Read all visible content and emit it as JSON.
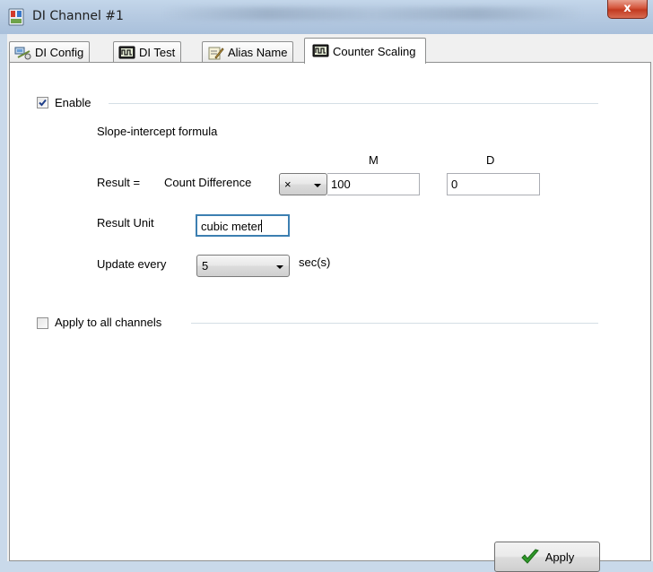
{
  "window": {
    "title": "DI Channel #1",
    "close_label": "x"
  },
  "tabs": [
    {
      "label": "DI Config",
      "icon": "network-config-icon",
      "active": false
    },
    {
      "label": "DI Test",
      "icon": "signal-monitor-icon",
      "active": false
    },
    {
      "label": "Alias Name",
      "icon": "pencil-note-icon",
      "active": false
    },
    {
      "label": "Counter Scaling",
      "icon": "signal-monitor-icon",
      "active": true
    }
  ],
  "enable": {
    "label": "Enable",
    "checked": true
  },
  "formula": {
    "heading": "Slope-intercept formula",
    "result_label": "Result =",
    "count_label": "Count Difference",
    "operator_value": "×",
    "m_header": "M",
    "d_header": "D",
    "m_value": "100",
    "d_value": "0"
  },
  "result_unit": {
    "label": "Result Unit",
    "value": "cubic meter"
  },
  "update": {
    "label": "Update every",
    "value": "5",
    "unit": "sec(s)"
  },
  "apply_all": {
    "label": "Apply to all channels",
    "checked": false
  },
  "apply_button": {
    "label": "Apply",
    "icon": "green-checkmark-icon"
  },
  "colors": {
    "accent_check": "#2f9a2a",
    "close_red": "#c23a20"
  }
}
